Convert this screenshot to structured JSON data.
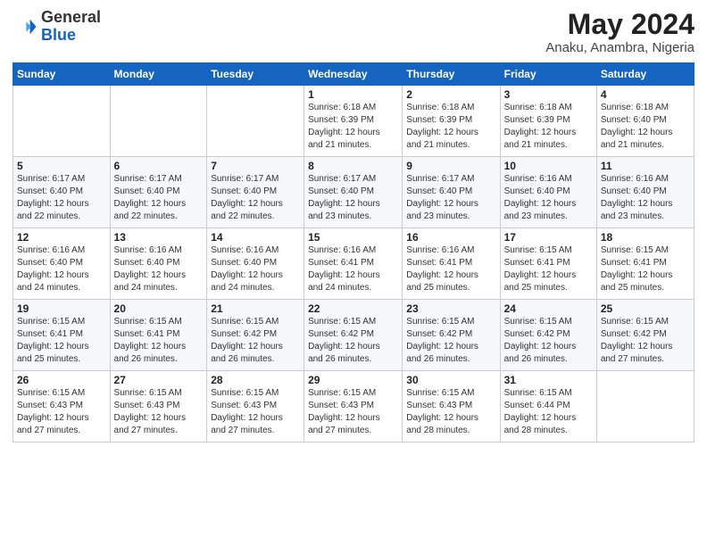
{
  "logo": {
    "general": "General",
    "blue": "Blue"
  },
  "header": {
    "title": "May 2024",
    "subtitle": "Anaku, Anambra, Nigeria"
  },
  "weekdays": [
    "Sunday",
    "Monday",
    "Tuesday",
    "Wednesday",
    "Thursday",
    "Friday",
    "Saturday"
  ],
  "weeks": [
    [
      {
        "day": "",
        "info": ""
      },
      {
        "day": "",
        "info": ""
      },
      {
        "day": "",
        "info": ""
      },
      {
        "day": "1",
        "info": "Sunrise: 6:18 AM\nSunset: 6:39 PM\nDaylight: 12 hours\nand 21 minutes."
      },
      {
        "day": "2",
        "info": "Sunrise: 6:18 AM\nSunset: 6:39 PM\nDaylight: 12 hours\nand 21 minutes."
      },
      {
        "day": "3",
        "info": "Sunrise: 6:18 AM\nSunset: 6:39 PM\nDaylight: 12 hours\nand 21 minutes."
      },
      {
        "day": "4",
        "info": "Sunrise: 6:18 AM\nSunset: 6:40 PM\nDaylight: 12 hours\nand 21 minutes."
      }
    ],
    [
      {
        "day": "5",
        "info": "Sunrise: 6:17 AM\nSunset: 6:40 PM\nDaylight: 12 hours\nand 22 minutes."
      },
      {
        "day": "6",
        "info": "Sunrise: 6:17 AM\nSunset: 6:40 PM\nDaylight: 12 hours\nand 22 minutes."
      },
      {
        "day": "7",
        "info": "Sunrise: 6:17 AM\nSunset: 6:40 PM\nDaylight: 12 hours\nand 22 minutes."
      },
      {
        "day": "8",
        "info": "Sunrise: 6:17 AM\nSunset: 6:40 PM\nDaylight: 12 hours\nand 23 minutes."
      },
      {
        "day": "9",
        "info": "Sunrise: 6:17 AM\nSunset: 6:40 PM\nDaylight: 12 hours\nand 23 minutes."
      },
      {
        "day": "10",
        "info": "Sunrise: 6:16 AM\nSunset: 6:40 PM\nDaylight: 12 hours\nand 23 minutes."
      },
      {
        "day": "11",
        "info": "Sunrise: 6:16 AM\nSunset: 6:40 PM\nDaylight: 12 hours\nand 23 minutes."
      }
    ],
    [
      {
        "day": "12",
        "info": "Sunrise: 6:16 AM\nSunset: 6:40 PM\nDaylight: 12 hours\nand 24 minutes."
      },
      {
        "day": "13",
        "info": "Sunrise: 6:16 AM\nSunset: 6:40 PM\nDaylight: 12 hours\nand 24 minutes."
      },
      {
        "day": "14",
        "info": "Sunrise: 6:16 AM\nSunset: 6:40 PM\nDaylight: 12 hours\nand 24 minutes."
      },
      {
        "day": "15",
        "info": "Sunrise: 6:16 AM\nSunset: 6:41 PM\nDaylight: 12 hours\nand 24 minutes."
      },
      {
        "day": "16",
        "info": "Sunrise: 6:16 AM\nSunset: 6:41 PM\nDaylight: 12 hours\nand 25 minutes."
      },
      {
        "day": "17",
        "info": "Sunrise: 6:15 AM\nSunset: 6:41 PM\nDaylight: 12 hours\nand 25 minutes."
      },
      {
        "day": "18",
        "info": "Sunrise: 6:15 AM\nSunset: 6:41 PM\nDaylight: 12 hours\nand 25 minutes."
      }
    ],
    [
      {
        "day": "19",
        "info": "Sunrise: 6:15 AM\nSunset: 6:41 PM\nDaylight: 12 hours\nand 25 minutes."
      },
      {
        "day": "20",
        "info": "Sunrise: 6:15 AM\nSunset: 6:41 PM\nDaylight: 12 hours\nand 26 minutes."
      },
      {
        "day": "21",
        "info": "Sunrise: 6:15 AM\nSunset: 6:42 PM\nDaylight: 12 hours\nand 26 minutes."
      },
      {
        "day": "22",
        "info": "Sunrise: 6:15 AM\nSunset: 6:42 PM\nDaylight: 12 hours\nand 26 minutes."
      },
      {
        "day": "23",
        "info": "Sunrise: 6:15 AM\nSunset: 6:42 PM\nDaylight: 12 hours\nand 26 minutes."
      },
      {
        "day": "24",
        "info": "Sunrise: 6:15 AM\nSunset: 6:42 PM\nDaylight: 12 hours\nand 26 minutes."
      },
      {
        "day": "25",
        "info": "Sunrise: 6:15 AM\nSunset: 6:42 PM\nDaylight: 12 hours\nand 27 minutes."
      }
    ],
    [
      {
        "day": "26",
        "info": "Sunrise: 6:15 AM\nSunset: 6:43 PM\nDaylight: 12 hours\nand 27 minutes."
      },
      {
        "day": "27",
        "info": "Sunrise: 6:15 AM\nSunset: 6:43 PM\nDaylight: 12 hours\nand 27 minutes."
      },
      {
        "day": "28",
        "info": "Sunrise: 6:15 AM\nSunset: 6:43 PM\nDaylight: 12 hours\nand 27 minutes."
      },
      {
        "day": "29",
        "info": "Sunrise: 6:15 AM\nSunset: 6:43 PM\nDaylight: 12 hours\nand 27 minutes."
      },
      {
        "day": "30",
        "info": "Sunrise: 6:15 AM\nSunset: 6:43 PM\nDaylight: 12 hours\nand 28 minutes."
      },
      {
        "day": "31",
        "info": "Sunrise: 6:15 AM\nSunset: 6:44 PM\nDaylight: 12 hours\nand 28 minutes."
      },
      {
        "day": "",
        "info": ""
      }
    ]
  ]
}
